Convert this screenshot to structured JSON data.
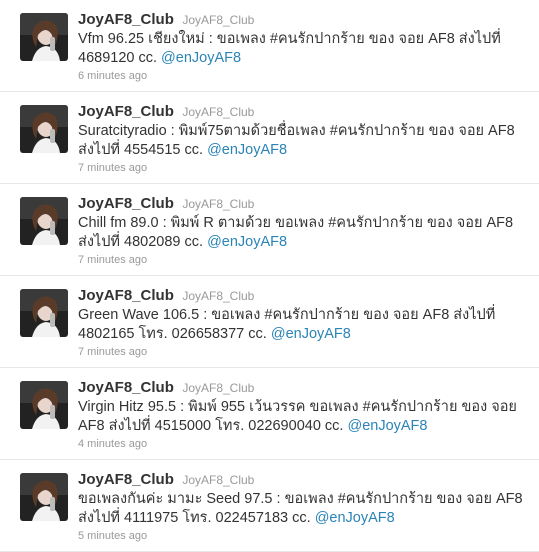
{
  "tweets": [
    {
      "name": "JoyAF8_Club",
      "screen_name": "JoyAF8_Club",
      "text": "Vfm 96.25 เชียงใหม่ : ขอเพลง #คนรักปากร้าย ของ จอย AF8 ส่งไปที่ 4689120 cc. ",
      "mention": "@enJoyAF8",
      "time": "6 minutes ago"
    },
    {
      "name": "JoyAF8_Club",
      "screen_name": "JoyAF8_Club",
      "text": "Suratcityradio : พิมพ์75ตามด้วยชื่อเพลง #คนรักปากร้าย ของ จอย AF8 ส่งไปที่ 4554515 cc. ",
      "mention": "@enJoyAF8",
      "time": "7 minutes ago"
    },
    {
      "name": "JoyAF8_Club",
      "screen_name": "JoyAF8_Club",
      "text": "Chill fm 89.0 : พิมพ์ R ตามด้วย ขอเพลง #คนรักปากร้าย ของ จอย AF8 ส่งไปที่ 4802089 cc. ",
      "mention": "@enJoyAF8",
      "time": "7 minutes ago"
    },
    {
      "name": "JoyAF8_Club",
      "screen_name": "JoyAF8_Club",
      "text": "Green Wave 106.5 : ขอเพลง #คนรักปากร้าย ของ จอย AF8 ส่งไปที่ 4802165 โทร. 026658377 cc. ",
      "mention": "@enJoyAF8",
      "time": "7 minutes ago"
    },
    {
      "name": "JoyAF8_Club",
      "screen_name": "JoyAF8_Club",
      "text": "Virgin Hitz 95.5 : พิมพ์ 955 เว้นวรรค ขอเพลง #คนรักปากร้าย ของ จอย AF8 ส่งไปที่ 4515000 โทร. 022690040 cc. ",
      "mention": "@enJoyAF8",
      "time": "4 minutes ago"
    },
    {
      "name": "JoyAF8_Club",
      "screen_name": "JoyAF8_Club",
      "text": "ขอเพลงกันค่ะ มามะ Seed 97.5 : ขอเพลง #คนรักปากร้าย ของ จอย AF8 ส่งไปที่ 4111975 โทร. 022457183 cc. ",
      "mention": "@enJoyAF8",
      "time": "5 minutes ago"
    }
  ]
}
